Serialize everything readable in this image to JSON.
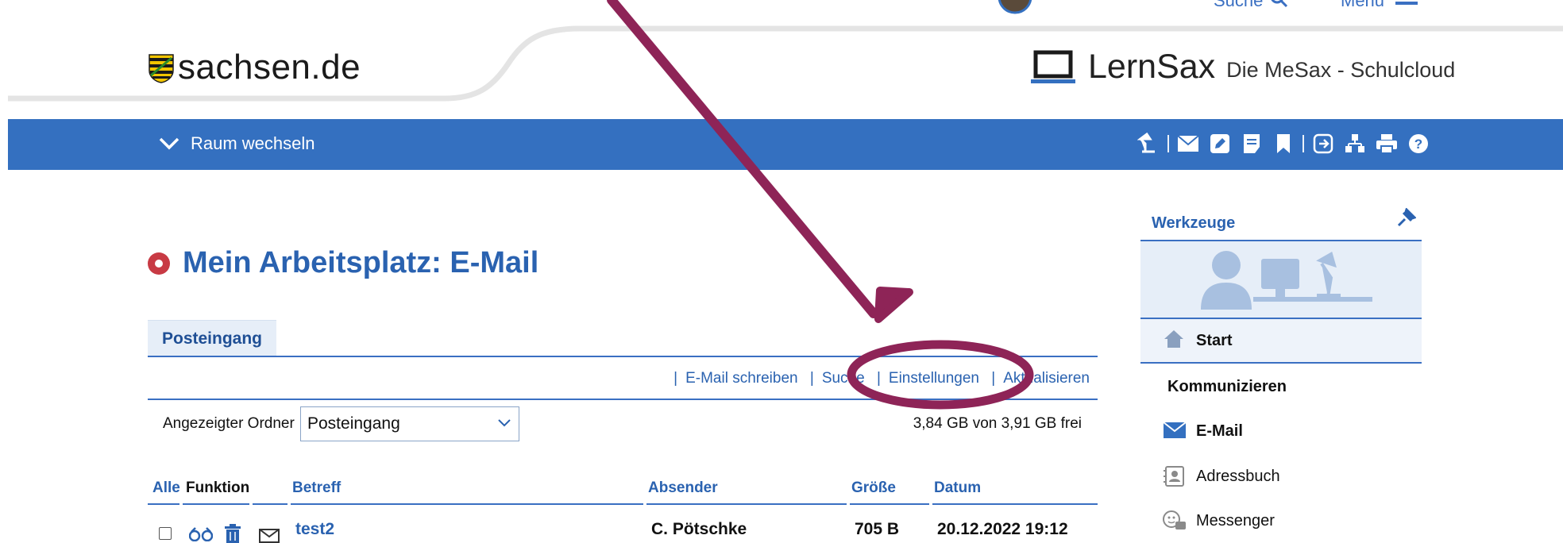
{
  "header": {
    "portal_name": "sachsen.de",
    "app_brand": "LernSax",
    "app_tagline": "Die MeSax - Schulcloud",
    "util_search_label": "Suche",
    "util_menu_label": "Menu"
  },
  "bluebar": {
    "room_switch_label": "Raum wechseln"
  },
  "page": {
    "title": "Mein Arbeitsplatz: E-Mail",
    "tab_inbox": "Posteingang"
  },
  "actions": {
    "write": "E-Mail schreiben",
    "search": "Suche",
    "settings": "Einstellungen",
    "refresh": "Aktualisieren"
  },
  "folder": {
    "label": "Angezeigter Ordner",
    "selected": "Posteingang",
    "quota": "3,84 GB von 3,91 GB frei"
  },
  "table": {
    "headers": {
      "all": "Alle",
      "function": "Funktion",
      "subject": "Betreff",
      "sender": "Absender",
      "size": "Größe",
      "date": "Datum"
    },
    "rows": [
      {
        "subject": "test2",
        "sender": "C. Pötschke",
        "size": "705 B",
        "date": "20.12.2022 19:12"
      }
    ]
  },
  "sidebar": {
    "title": "Werkzeuge",
    "start": "Start",
    "section_communicate": "Kommunizieren",
    "items": [
      {
        "label": "E-Mail",
        "icon": "envelope-icon"
      },
      {
        "label": "Adressbuch",
        "icon": "address-book-icon"
      },
      {
        "label": "Messenger",
        "icon": "messenger-icon"
      }
    ]
  },
  "colors": {
    "brand_blue": "#3470c0",
    "link_blue": "#2a62b0",
    "annotation": "#8e2457",
    "title_dot": "#c83a44"
  }
}
